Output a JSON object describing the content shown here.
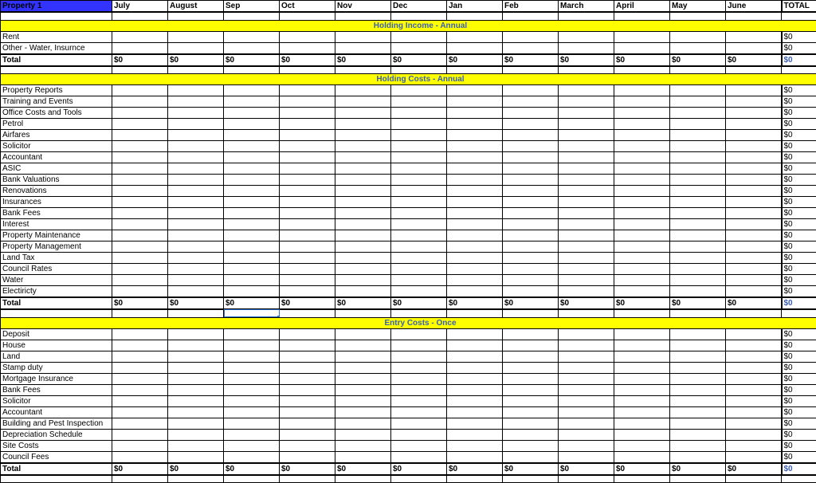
{
  "header": {
    "property": "Property 1",
    "months": [
      "July",
      "August",
      "Sep",
      "Oct",
      "Nov",
      "Dec",
      "Jan",
      "Feb",
      "March",
      "April",
      "May",
      "June"
    ],
    "total": "TOTAL"
  },
  "sections": [
    {
      "title": "Holding Income - Annual",
      "rows": [
        {
          "label": "Rent",
          "vals": [
            "",
            "",
            "",
            "",
            "",
            "",
            "",
            "",
            "",
            "",
            "",
            ""
          ],
          "total": "$0"
        },
        {
          "label": "Other - Water, Insurnce",
          "vals": [
            "",
            "",
            "",
            "",
            "",
            "",
            "",
            "",
            "",
            "",
            "",
            ""
          ],
          "total": "$0"
        }
      ],
      "total": {
        "label": "Total",
        "vals": [
          "$0",
          "$0",
          "$0",
          "$0",
          "$0",
          "$0",
          "$0",
          "$0",
          "$0",
          "$0",
          "$0",
          "$0"
        ],
        "total": "$0"
      }
    },
    {
      "title": "Holding Costs - Annual",
      "rows": [
        {
          "label": "Property Reports",
          "vals": [
            "",
            "",
            "",
            "",
            "",
            "",
            "",
            "",
            "",
            "",
            "",
            ""
          ],
          "total": "$0"
        },
        {
          "label": "Training and Events",
          "vals": [
            "",
            "",
            "",
            "",
            "",
            "",
            "",
            "",
            "",
            "",
            "",
            ""
          ],
          "total": "$0"
        },
        {
          "label": "Office Costs and Tools",
          "vals": [
            "",
            "",
            "",
            "",
            "",
            "",
            "",
            "",
            "",
            "",
            "",
            ""
          ],
          "total": "$0"
        },
        {
          "label": "Petrol",
          "vals": [
            "",
            "",
            "",
            "",
            "",
            "",
            "",
            "",
            "",
            "",
            "",
            ""
          ],
          "total": "$0"
        },
        {
          "label": "Airfares",
          "vals": [
            "",
            "",
            "",
            "",
            "",
            "",
            "",
            "",
            "",
            "",
            "",
            ""
          ],
          "total": "$0"
        },
        {
          "label": "Solicitor",
          "vals": [
            "",
            "",
            "",
            "",
            "",
            "",
            "",
            "",
            "",
            "",
            "",
            ""
          ],
          "total": "$0"
        },
        {
          "label": "Accountant",
          "vals": [
            "",
            "",
            "",
            "",
            "",
            "",
            "",
            "",
            "",
            "",
            "",
            ""
          ],
          "total": "$0"
        },
        {
          "label": "ASIC",
          "vals": [
            "",
            "",
            "",
            "",
            "",
            "",
            "",
            "",
            "",
            "",
            "",
            ""
          ],
          "total": "$0"
        },
        {
          "label": "Bank Valuations",
          "vals": [
            "",
            "",
            "",
            "",
            "",
            "",
            "",
            "",
            "",
            "",
            "",
            ""
          ],
          "total": "$0"
        },
        {
          "label": "Renovations",
          "vals": [
            "",
            "",
            "",
            "",
            "",
            "",
            "",
            "",
            "",
            "",
            "",
            ""
          ],
          "total": "$0"
        },
        {
          "label": "Insurances",
          "vals": [
            "",
            "",
            "",
            "",
            "",
            "",
            "",
            "",
            "",
            "",
            "",
            ""
          ],
          "total": "$0"
        },
        {
          "label": "Bank Fees",
          "vals": [
            "",
            "",
            "",
            "",
            "",
            "",
            "",
            "",
            "",
            "",
            "",
            ""
          ],
          "total": "$0"
        },
        {
          "label": "Interest",
          "vals": [
            "",
            "",
            "",
            "",
            "",
            "",
            "",
            "",
            "",
            "",
            "",
            ""
          ],
          "total": "$0"
        },
        {
          "label": "Property Maintenance",
          "vals": [
            "",
            "",
            "",
            "",
            "",
            "",
            "",
            "",
            "",
            "",
            "",
            ""
          ],
          "total": "$0"
        },
        {
          "label": "Property Management",
          "vals": [
            "",
            "",
            "",
            "",
            "",
            "",
            "",
            "",
            "",
            "",
            "",
            ""
          ],
          "total": "$0"
        },
        {
          "label": "Land Tax",
          "vals": [
            "",
            "",
            "",
            "",
            "",
            "",
            "",
            "",
            "",
            "",
            "",
            ""
          ],
          "total": "$0"
        },
        {
          "label": "Council Rates",
          "vals": [
            "",
            "",
            "",
            "",
            "",
            "",
            "",
            "",
            "",
            "",
            "",
            ""
          ],
          "total": "$0"
        },
        {
          "label": "Water",
          "vals": [
            "",
            "",
            "",
            "",
            "",
            "",
            "",
            "",
            "",
            "",
            "",
            ""
          ],
          "total": "$0"
        },
        {
          "label": "Electiricty",
          "vals": [
            "",
            "",
            "",
            "",
            "",
            "",
            "",
            "",
            "",
            "",
            "",
            ""
          ],
          "total": "$0"
        }
      ],
      "total": {
        "label": "Total",
        "vals": [
          "$0",
          "$0",
          "$0",
          "$0",
          "$0",
          "$0",
          "$0",
          "$0",
          "$0",
          "$0",
          "$0",
          "$0"
        ],
        "total": "$0"
      },
      "selectedCellBelowIndex": 2
    },
    {
      "title": "Entry Costs - Once",
      "rows": [
        {
          "label": "Deposit",
          "vals": [
            "",
            "",
            "",
            "",
            "",
            "",
            "",
            "",
            "",
            "",
            "",
            ""
          ],
          "total": "$0"
        },
        {
          "label": "House",
          "vals": [
            "",
            "",
            "",
            "",
            "",
            "",
            "",
            "",
            "",
            "",
            "",
            ""
          ],
          "total": "$0"
        },
        {
          "label": "Land",
          "vals": [
            "",
            "",
            "",
            "",
            "",
            "",
            "",
            "",
            "",
            "",
            "",
            ""
          ],
          "total": "$0"
        },
        {
          "label": "Stamp duty",
          "vals": [
            "",
            "",
            "",
            "",
            "",
            "",
            "",
            "",
            "",
            "",
            "",
            ""
          ],
          "total": "$0"
        },
        {
          "label": "Mortgage Insurance",
          "vals": [
            "",
            "",
            "",
            "",
            "",
            "",
            "",
            "",
            "",
            "",
            "",
            ""
          ],
          "total": "$0"
        },
        {
          "label": "Bank Fees",
          "vals": [
            "",
            "",
            "",
            "",
            "",
            "",
            "",
            "",
            "",
            "",
            "",
            ""
          ],
          "total": "$0"
        },
        {
          "label": "Solicitor",
          "vals": [
            "",
            "",
            "",
            "",
            "",
            "",
            "",
            "",
            "",
            "",
            "",
            ""
          ],
          "total": "$0"
        },
        {
          "label": "Accountant",
          "vals": [
            "",
            "",
            "",
            "",
            "",
            "",
            "",
            "",
            "",
            "",
            "",
            ""
          ],
          "total": "$0"
        },
        {
          "label": "Building and Pest Inspection",
          "vals": [
            "",
            "",
            "",
            "",
            "",
            "",
            "",
            "",
            "",
            "",
            "",
            ""
          ],
          "total": "$0"
        },
        {
          "label": "Depreciation Schedule",
          "vals": [
            "",
            "",
            "",
            "",
            "",
            "",
            "",
            "",
            "",
            "",
            "",
            ""
          ],
          "total": "$0"
        },
        {
          "label": "Site Costs",
          "vals": [
            "",
            "",
            "",
            "",
            "",
            "",
            "",
            "",
            "",
            "",
            "",
            ""
          ],
          "total": "$0"
        },
        {
          "label": "Council Fees",
          "vals": [
            "",
            "",
            "",
            "",
            "",
            "",
            "",
            "",
            "",
            "",
            "",
            ""
          ],
          "total": "$0"
        }
      ],
      "total": {
        "label": "Total",
        "vals": [
          "$0",
          "$0",
          "$0",
          "$0",
          "$0",
          "$0",
          "$0",
          "$0",
          "$0",
          "$0",
          "$0",
          "$0"
        ],
        "total": "$0"
      }
    }
  ]
}
